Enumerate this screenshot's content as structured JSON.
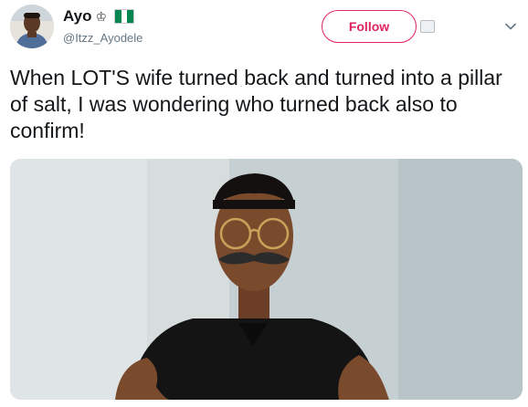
{
  "author": {
    "display_name": "Ayo",
    "badge_glyph": "♔",
    "handle": "@Itzz_Ayodele",
    "flag_colors": [
      "#008751",
      "#ffffff",
      "#008751"
    ]
  },
  "follow_button": {
    "label": "Follow",
    "color": "#e0245e"
  },
  "icons": {
    "more": "chevron-down-icon",
    "follow_status": "user-card-icon"
  },
  "tweet": {
    "text": "When LOT'S wife turned back and turned into a pillar of salt, I was wondering who turned back also to confirm!"
  },
  "colors": {
    "text": "#14171a",
    "secondary": "#657786"
  }
}
